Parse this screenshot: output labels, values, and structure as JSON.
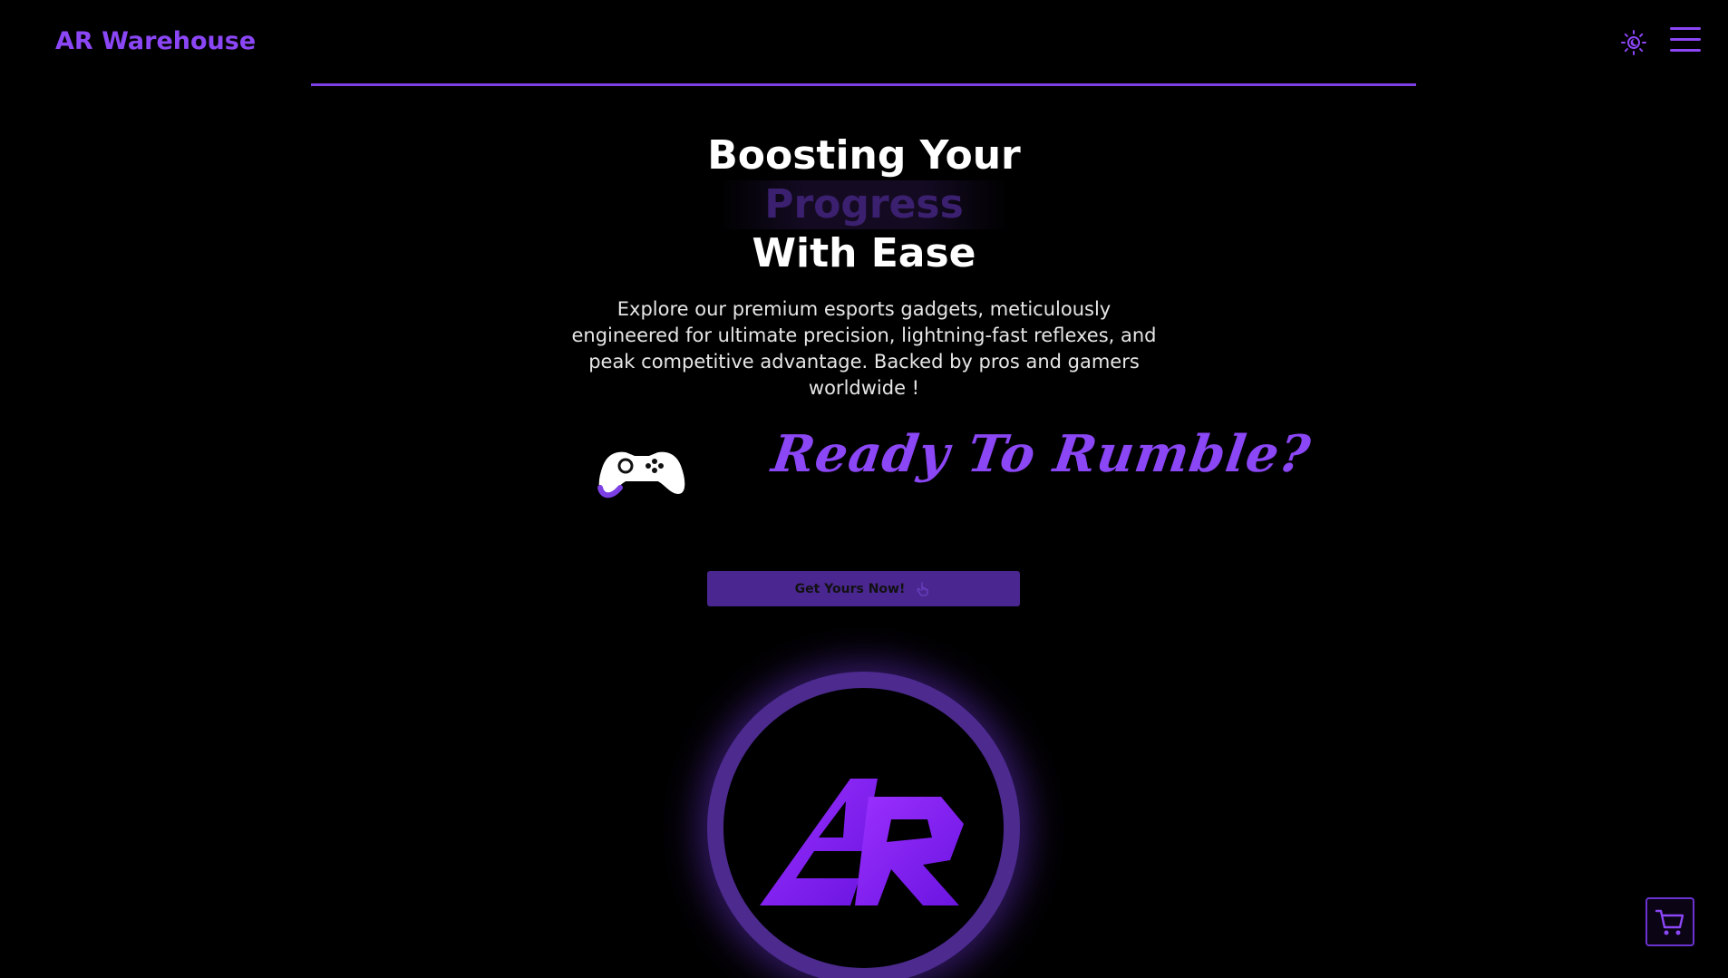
{
  "header": {
    "brand": "AR Warehouse",
    "theme_toggle_icon": "sun-moon-icon",
    "menu_icon": "hamburger-menu-icon"
  },
  "hero": {
    "title_line1": "Boosting Your",
    "title_line2": "Progress",
    "title_line3": "With Ease",
    "description": "Explore our premium esports gadgets, meticulously engineered for ultimate precision, lightning-fast reflexes, and peak competitive advantage. Backed by pros and gamers worldwide !",
    "tagline": "Ready To Rumble?",
    "cta_label": "Get Yours Now!",
    "cta_icon": "pointer-hand-icon"
  },
  "logo": {
    "letters": "AR"
  },
  "floating": {
    "cart_icon": "shopping-cart-icon"
  },
  "colors": {
    "accent": "#8b46f5",
    "accent_dark": "#4a2790",
    "background": "#000000",
    "text": "#ffffff"
  }
}
